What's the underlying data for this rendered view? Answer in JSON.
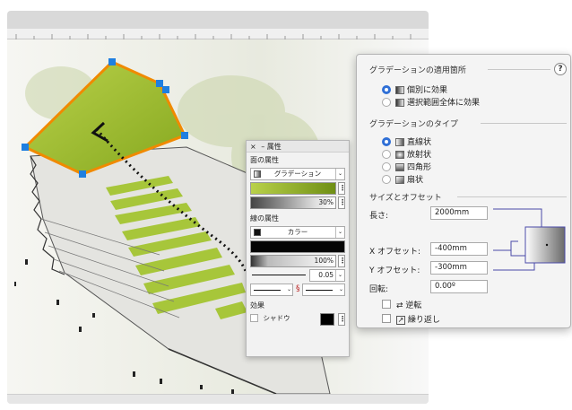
{
  "properties_panel": {
    "title": "属性",
    "close_label": "×",
    "minimize_label": "–",
    "fill_section": "面の属性",
    "fill_type": "グラデーション",
    "fill_opacity": "30%",
    "stroke_section": "線の属性",
    "stroke_type": "カラー",
    "stroke_opacity": "100%",
    "stroke_width": "0.05",
    "effects_section": "効果",
    "shadow_label": "シャドウ",
    "more_glyph": "⋮",
    "dropdown_glyph": "⌄"
  },
  "gradient_panel": {
    "apply_section": "グラデーションの適用箇所",
    "help_label": "?",
    "apply_options": [
      {
        "label": "個別に効果",
        "selected": true
      },
      {
        "label": "選択範囲全体に効果",
        "selected": false
      }
    ],
    "type_section": "グラデーションのタイプ",
    "type_options": [
      {
        "label": "直線状",
        "selected": true
      },
      {
        "label": "放射状",
        "selected": false
      },
      {
        "label": "四角形",
        "selected": false
      },
      {
        "label": "扇状",
        "selected": false
      }
    ],
    "size_section": "サイズとオフセット",
    "length_label": "長さ:",
    "length_value": "2000mm",
    "x_offset_label": "X オフセット:",
    "x_offset_value": "-400mm",
    "y_offset_label": "Y オフセット:",
    "y_offset_value": "-300mm",
    "rotation_label": "回転:",
    "rotation_value": "0.00º",
    "reverse_label": "逆転",
    "reverse_icon": "⇄",
    "repeat_label": "繰り返し",
    "repeat_icon": "↗"
  },
  "colors": {
    "selection_orange": "#f08a00",
    "handle_blue": "#1f7fe0",
    "fill_green": "#9bbf2a",
    "radio_blue": "#2f6fd6"
  }
}
